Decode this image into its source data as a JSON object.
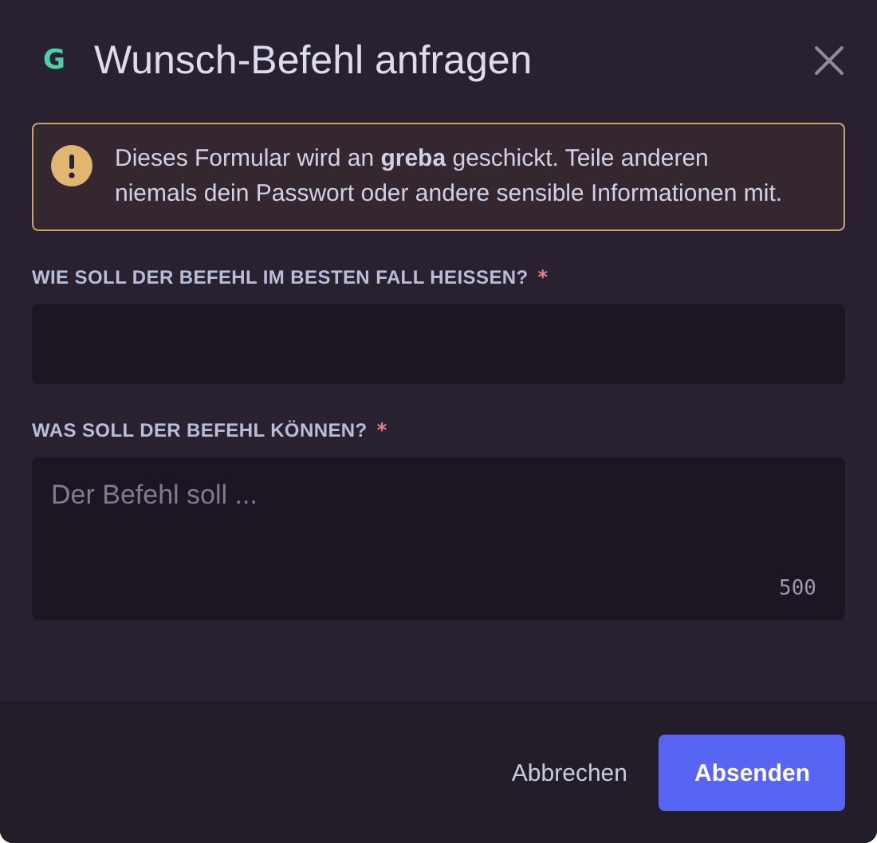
{
  "dialog": {
    "logo": "G",
    "title": "Wunsch-Befehl anfragen"
  },
  "notice": {
    "text": "Dieses Formular wird an **greba** geschickt. Teile anderen niemals dein Passwort oder andere sensible Informationen mit."
  },
  "fields": [
    {
      "kind": "input",
      "label": "WIE SOLL DER BEFEHL IM BESTEN FALL HEISSEN?",
      "required_mark": "*"
    },
    {
      "kind": "textarea",
      "label": "WAS SOLL DER BEFEHL KÖNNEN?",
      "required_mark": "*",
      "placeholder": "Der Befehl soll ...",
      "counter": "500"
    }
  ],
  "buttons": [
    {
      "kind": "link",
      "label": "Abbrechen"
    },
    {
      "kind": "primary",
      "label": "Absenden"
    }
  ]
}
